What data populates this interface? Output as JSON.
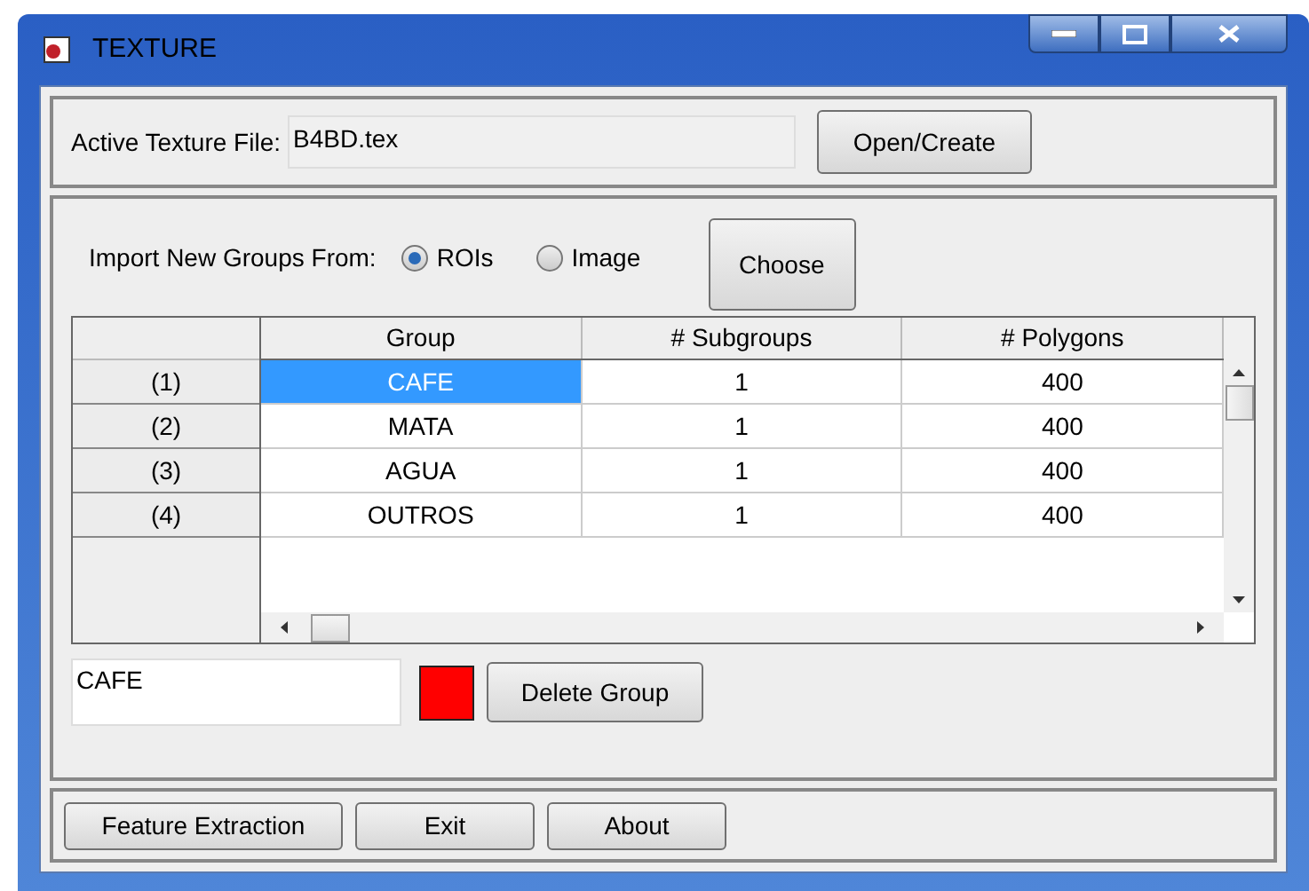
{
  "window": {
    "title": "TEXTURE"
  },
  "active_file": {
    "label": "Active Texture File:",
    "value": "B4BD.tex",
    "button": "Open/Create"
  },
  "import": {
    "label": "Import New Groups From:",
    "options": [
      {
        "label": "ROIs",
        "selected": true
      },
      {
        "label": "Image",
        "selected": false
      }
    ],
    "button": "Choose"
  },
  "table": {
    "columns": [
      "Group",
      "# Subgroups",
      "# Polygons"
    ],
    "rows": [
      {
        "header": "(1)",
        "cells": [
          "CAFE",
          "1",
          "400"
        ],
        "selected": true
      },
      {
        "header": "(2)",
        "cells": [
          "MATA",
          "1",
          "400"
        ],
        "selected": false
      },
      {
        "header": "(3)",
        "cells": [
          "AGUA",
          "1",
          "400"
        ],
        "selected": false
      },
      {
        "header": "(4)",
        "cells": [
          "OUTROS",
          "1",
          "400"
        ],
        "selected": false
      }
    ]
  },
  "group_editor": {
    "name": "CAFE",
    "color": "#ff0000",
    "button": "Delete Group"
  },
  "footer_buttons": [
    "Feature Extraction",
    "Exit",
    "About"
  ]
}
